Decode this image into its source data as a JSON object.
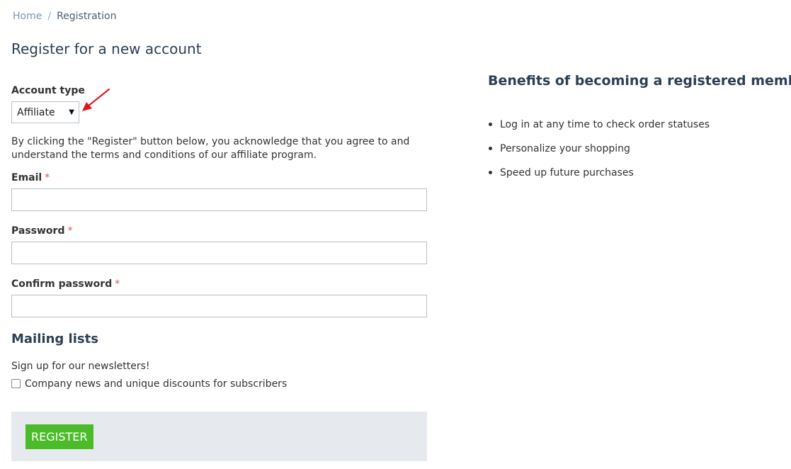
{
  "breadcrumb": {
    "home": "Home",
    "separator": "/",
    "current": "Registration"
  },
  "page_title": "Register for a new account",
  "account_type": {
    "label": "Account type",
    "selected": "Affiliate"
  },
  "agreement_text": "By clicking the \"Register\" button below, you acknowledge that you agree to and understand the terms and conditions of our affiliate program.",
  "fields": {
    "email": {
      "label": "Email",
      "required_mark": "*",
      "value": ""
    },
    "password": {
      "label": "Password",
      "required_mark": "*",
      "value": ""
    },
    "confirm_password": {
      "label": "Confirm password",
      "required_mark": "*",
      "value": ""
    }
  },
  "mailing": {
    "title": "Mailing lists",
    "signup_text": "Sign up for our newsletters!",
    "checkbox_label": "Company news and unique discounts for subscribers",
    "checked": false
  },
  "register_button": "REGISTER",
  "benefits": {
    "title": "Benefits of becoming a registered member",
    "items": [
      "Log in at any time to check order statuses",
      "Personalize your shopping",
      "Speed up future purchases"
    ]
  },
  "colors": {
    "button_green": "#4cbb2a",
    "required_red": "#d9534f",
    "annotation_arrow_red": "#e0161c",
    "heading_navy": "#2d3f52",
    "button_bar_gray": "#e6eaee"
  },
  "icons": {
    "select_arrow": "dropdown-triangle-icon",
    "annotation": "red-pointer-arrow-icon"
  }
}
